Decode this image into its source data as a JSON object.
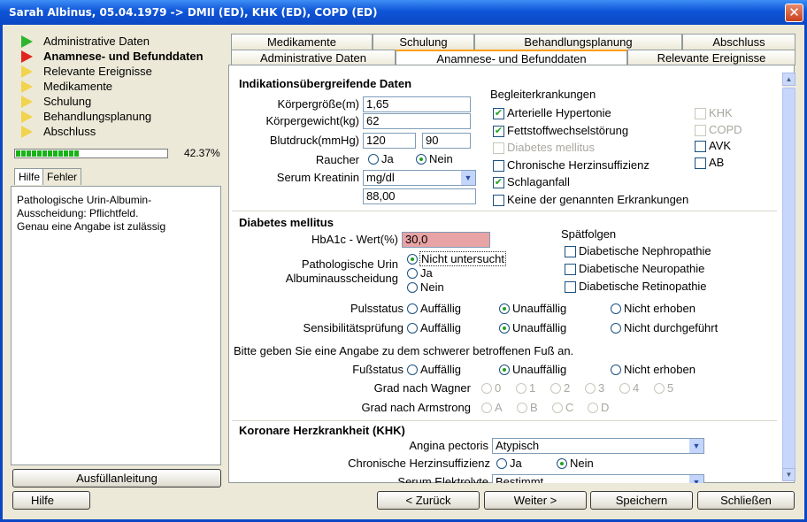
{
  "window": {
    "title": "Sarah Albinus, 05.04.1979 -> DMII (ED), KHK (ED), COPD (ED)",
    "close_glyph": "✕"
  },
  "nav": {
    "items": [
      {
        "label": "Administrative Daten",
        "color": "green"
      },
      {
        "label": "Anamnese- und Befunddaten",
        "color": "red",
        "active": true
      },
      {
        "label": "Relevante Ereignisse",
        "color": "yellow"
      },
      {
        "label": "Medikamente",
        "color": "yellow"
      },
      {
        "label": "Schulung",
        "color": "yellow"
      },
      {
        "label": "Behandlungsplanung",
        "color": "yellow"
      },
      {
        "label": "Abschluss",
        "color": "yellow"
      }
    ],
    "progress_fraction": 0.4237,
    "progress_label": "42.37%"
  },
  "help": {
    "tab_help": "Hilfe",
    "tab_error": "Fehler",
    "text": "Pathologische Urin-Albumin-\nAusscheidung: Pflichtfeld.\nGenau eine Angabe ist zulässig",
    "fill_guide_button": "Ausfüllanleitung"
  },
  "tabs": {
    "row1": [
      "Medikamente",
      "Schulung",
      "Behandlungsplanung",
      "Abschluss"
    ],
    "row2": [
      "Administrative Daten",
      "Anamnese- und Befunddaten",
      "Relevante Ereignisse"
    ]
  },
  "indication": {
    "heading": "Indikationsübergreifende Daten",
    "height_label": "Körpergröße(m)",
    "height_value": "1,65",
    "weight_label": "Körpergewicht(kg)",
    "weight_value": "62",
    "bp_label": "Blutdruck(mmHg)",
    "bp_sys": "120",
    "bp_dia": "90",
    "smoker_label": "Raucher",
    "smoker_yes": "Ja",
    "smoker_no": "Nein",
    "smoker_selected": "Nein",
    "creatinine_label": "Serum Kreatinin",
    "creatinine_unit": "mg/dl",
    "creatinine_value": "88,00",
    "comorb_heading": "Begleiterkrankungen",
    "comorb": [
      {
        "label": "Arterielle Hypertonie",
        "checked": true,
        "enabled": true
      },
      {
        "label": "Fettstoffwechselstörung",
        "checked": true,
        "enabled": true
      },
      {
        "label": "Diabetes mellitus",
        "checked": false,
        "enabled": false
      },
      {
        "label": "Chronische Herzinsuffizienz",
        "checked": false,
        "enabled": true
      },
      {
        "label": "Schlaganfall",
        "checked": true,
        "enabled": true
      },
      {
        "label": "Keine der genannten Erkrankungen",
        "checked": false,
        "enabled": true
      }
    ],
    "comorb_right": [
      {
        "label": "KHK",
        "checked": false,
        "enabled": false
      },
      {
        "label": "COPD",
        "checked": false,
        "enabled": false
      },
      {
        "label": "AVK",
        "checked": false,
        "enabled": true
      },
      {
        "label": "AB",
        "checked": false,
        "enabled": true
      }
    ]
  },
  "diabetes": {
    "heading": "Diabetes mellitus",
    "hba1c_label": "HbA1c - Wert(%)",
    "hba1c_value": "30,0",
    "urin_label_1": "Pathologische Urin",
    "urin_label_2": "Albuminausscheidung",
    "urin_options": [
      "Nicht untersucht",
      "Ja",
      "Nein"
    ],
    "urin_selected": "Nicht untersucht",
    "late_heading": "Spätfolgen",
    "late": [
      {
        "label": "Diabetische Nephropathie",
        "checked": false
      },
      {
        "label": "Diabetische Neuropathie",
        "checked": false
      },
      {
        "label": "Diabetische Retinopathie",
        "checked": false
      }
    ],
    "pulse_label": "Pulsstatus",
    "pulse_options": [
      "Auffällig",
      "Unauffällig",
      "Nicht erhoben"
    ],
    "pulse_selected": "Unauffällig",
    "sens_label": "Sensibilitätsprüfung",
    "sens_options": [
      "Auffällig",
      "Unauffällig",
      "Nicht durchgeführt"
    ],
    "sens_selected": "Unauffällig",
    "foot_instruction": "Bitte geben Sie eine Angabe zu dem schwerer betroffenen Fuß an.",
    "foot_label": "Fußstatus",
    "foot_options": [
      "Auffällig",
      "Unauffällig",
      "Nicht erhoben"
    ],
    "foot_selected": "Unauffällig",
    "wagner_label": "Grad nach Wagner",
    "wagner_options": [
      "0",
      "1",
      "2",
      "3",
      "4",
      "5"
    ],
    "armstrong_label": "Grad nach Armstrong",
    "armstrong_options": [
      "A",
      "B",
      "C",
      "D"
    ]
  },
  "khk": {
    "heading": "Koronare Herzkrankheit (KHK)",
    "angina_label": "Angina pectoris",
    "angina_value": "Atypisch",
    "chf_label": "Chronische Herzinsuffizienz",
    "chf_yes": "Ja",
    "chf_no": "Nein",
    "chf_selected": "Nein",
    "electrolytes_label": "Serum Elektrolyte",
    "electrolytes_value": "Bestimmt"
  },
  "footer": {
    "help": "Hilfe",
    "back": "< Zurück",
    "next": "Weiter >",
    "save": "Speichern",
    "close": "Schließen"
  },
  "colors": {
    "title_bar": "#0b47c4",
    "selected_tab_accent": "#ff9e1a",
    "error_field": "#e8a3a4",
    "progress": "#19b219"
  }
}
